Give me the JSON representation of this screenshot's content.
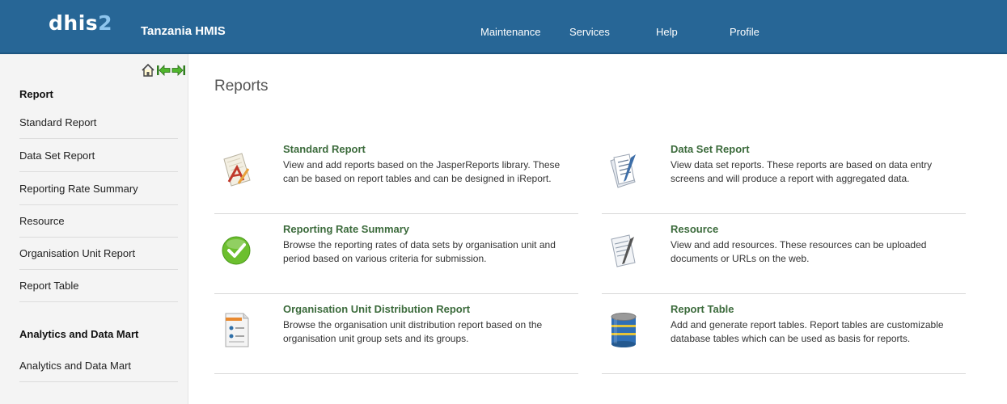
{
  "header": {
    "logo_text": "dhis",
    "logo_num": "2",
    "app_title": "Tanzania HMIS",
    "menu": [
      "Maintenance",
      "Services",
      "Help",
      "Profile"
    ]
  },
  "sidebar": {
    "sections": [
      {
        "heading": "Report",
        "items": [
          "Standard Report",
          "Data Set Report",
          "Reporting Rate Summary",
          "Resource",
          "Organisation Unit Report",
          "Report Table"
        ]
      },
      {
        "heading": "Analytics and Data Mart",
        "items": [
          "Analytics and Data Mart"
        ]
      }
    ]
  },
  "main": {
    "title": "Reports",
    "cards": [
      {
        "title": "Standard Report",
        "desc": "View and add reports based on the JasperReports library. These can be based on report tables and can be designed in iReport.",
        "icon": "standard-report-icon"
      },
      {
        "title": "Data Set Report",
        "desc": "View data set reports. These reports are based on data entry screens and will produce a report with aggregated data.",
        "icon": "data-set-report-icon"
      },
      {
        "title": "Reporting Rate Summary",
        "desc": "Browse the reporting rates of data sets by organisation unit and period based on various criteria for submission.",
        "icon": "checkmark-icon"
      },
      {
        "title": "Resource",
        "desc": "View and add resources. These resources can be uploaded documents or URLs on the web.",
        "icon": "resource-icon"
      },
      {
        "title": "Organisation Unit Distribution Report",
        "desc": "Browse the organisation unit distribution report based on the organisation unit group sets and its groups.",
        "icon": "org-unit-report-icon"
      },
      {
        "title": "Report Table",
        "desc": "Add and generate report tables. Report tables are customizable database tables which can be used as basis for reports.",
        "icon": "database-icon"
      }
    ]
  },
  "colors": {
    "header": "#276696",
    "card_title": "#3c6b3c",
    "sidebar_bg": "#f4f4f4"
  }
}
